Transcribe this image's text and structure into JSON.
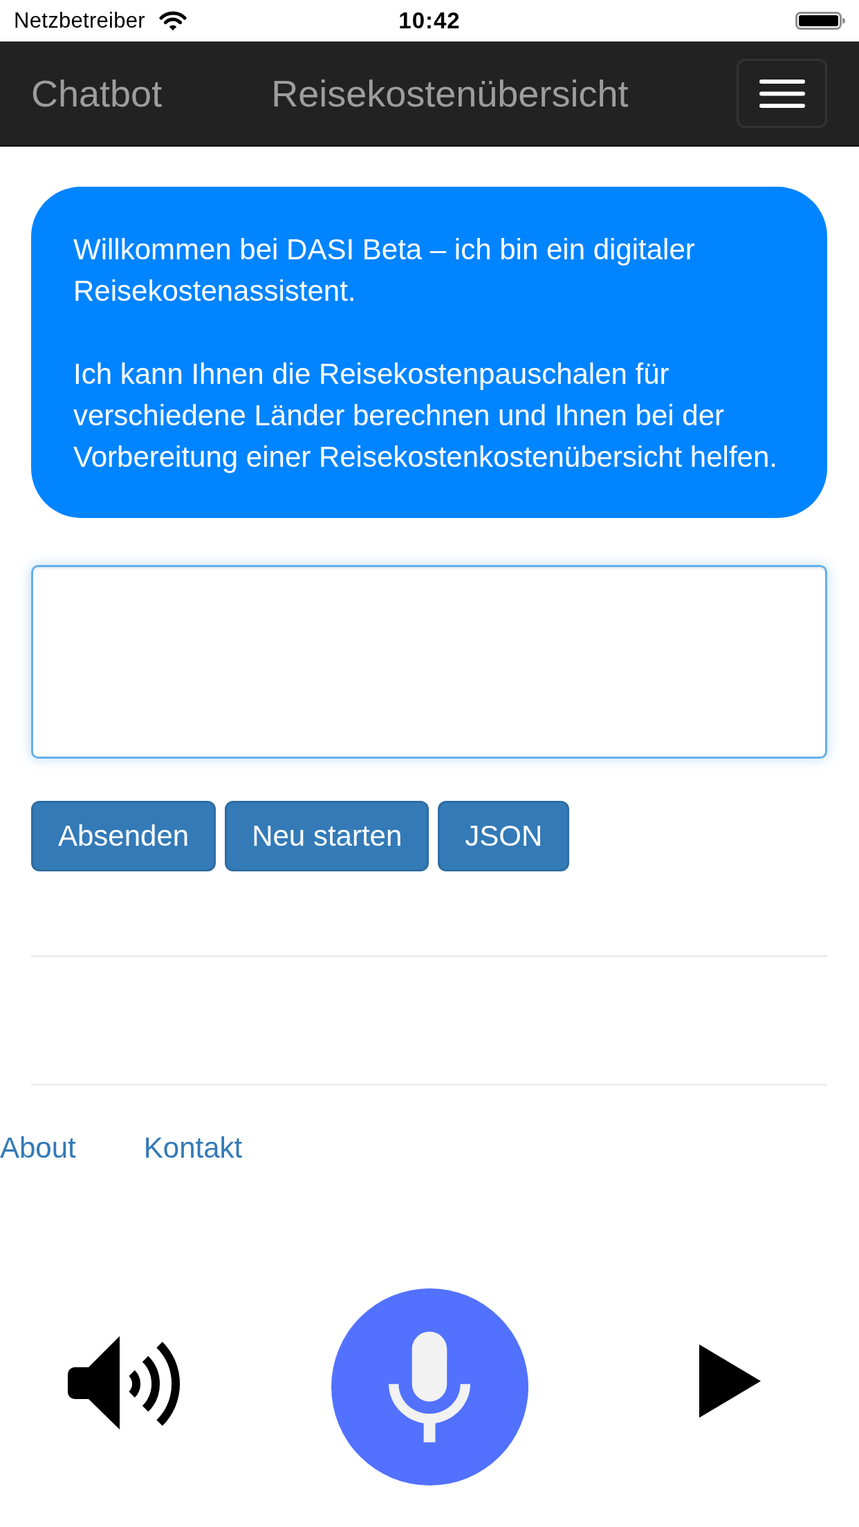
{
  "status_bar": {
    "carrier": "Netzbetreiber",
    "time": "10:42"
  },
  "navbar": {
    "brand": "Chatbot",
    "title": "Reisekostenübersicht"
  },
  "message": {
    "paragraphs": [
      "Willkommen bei DASI Beta – ich bin ein digitaler Reisekostenassistent.",
      "Ich kann Ihnen die Reisekostenpauschalen für verschiedene Länder berechnen und Ihnen bei der Vorbereitung einer Reisekostenkostenübersicht helfen."
    ]
  },
  "buttons": [
    "Absenden",
    "Neu starten",
    "JSON"
  ],
  "footer_links": [
    "About",
    "Kontakt"
  ]
}
